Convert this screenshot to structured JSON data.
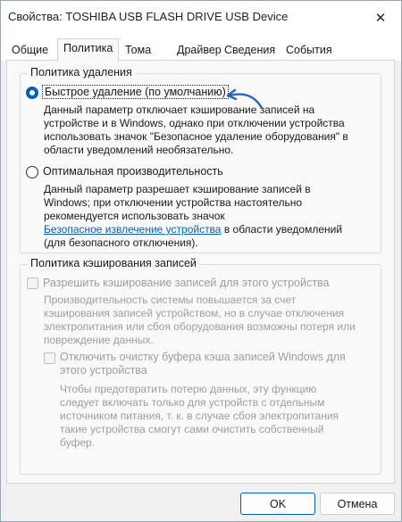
{
  "window": {
    "title": "Свойства: TOSHIBA USB FLASH DRIVE USB Device",
    "close_glyph": "✕"
  },
  "tabs": [
    {
      "label": "Общие",
      "active": false
    },
    {
      "label": "Политика",
      "active": true
    },
    {
      "label": "Тома",
      "active": false
    },
    {
      "label": "Драйвер",
      "active": false
    },
    {
      "label": "Сведения",
      "active": false
    },
    {
      "label": "События",
      "active": false
    }
  ],
  "removal_policy": {
    "title": "Политика удаления",
    "quick": {
      "label": "Быстрое удаление (по умолчанию)",
      "checked": true,
      "description": [
        "Данный параметр отключает кэширование записей на",
        "устройстве и в Windows, однако при отключении устройства",
        "использовать значок \"Безопасное удаление оборудования\" в",
        "области уведомлений необязательно."
      ]
    },
    "performance": {
      "label": "Оптимальная производительность",
      "checked": false,
      "description": [
        "Данный параметр разрешает кэширование записей в",
        "Windows; при отключении устройства настоятельно",
        "рекомендуется использовать значок"
      ],
      "link_text": "Безопасное извлечение устройства",
      "after_link": " в области уведомлений",
      "last_line": "(для безопасного отключения)."
    }
  },
  "write_cache_policy": {
    "title": "Политика кэширования записей",
    "enable": {
      "label": "Разрешить кэширование записей для этого устройства",
      "checked": false,
      "enabled": false,
      "description": [
        "Производительность системы повышается за счет",
        "кэширования записей устройством, но в случае отключения",
        "электропитания или сбоя оборудования возможны потеря или",
        "повреждение данных."
      ]
    },
    "flush": {
      "label_lines": [
        "Отключить очистку буфера кэша записей Windows для",
        "этого устройства"
      ],
      "checked": false,
      "enabled": false,
      "description": [
        "Чтобы предотвратить потерю данных, эту функцию",
        "следует включать только для устройств с отдельным",
        "источником питания, т. к.  в случае сбоя электропитания",
        "такие устройства смогут сами очистить собственный",
        "буфер."
      ]
    }
  },
  "buttons": {
    "ok": "OK",
    "cancel": "Отмена"
  },
  "colors": {
    "accent": "#005fb8",
    "link": "#0a5fb5",
    "disabled_text": "#9d9d9d",
    "annotation_arrow": "#2b64c6"
  }
}
